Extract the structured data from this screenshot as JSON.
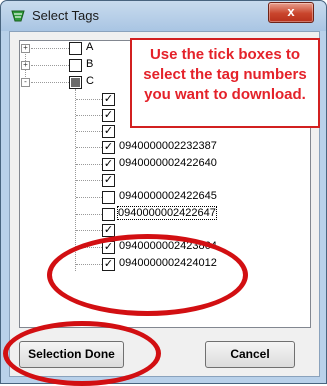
{
  "window": {
    "title": "Select Tags",
    "close_label": "x"
  },
  "tree": {
    "groups": [
      {
        "label": "A",
        "expander": "+"
      },
      {
        "label": "B",
        "expander": "+"
      },
      {
        "label": "C",
        "expander": "-"
      }
    ],
    "items": [
      {
        "label": "0940000002232387",
        "checked": true
      },
      {
        "label": "0940000002422640",
        "checked": true
      },
      {
        "label": "0940000002422645",
        "checked": false
      },
      {
        "label": "0940000002422647",
        "checked": false
      },
      {
        "label": "0940000002423864",
        "checked": true
      },
      {
        "label": "0940000002424012",
        "checked": true
      }
    ],
    "check_mark": "✓"
  },
  "callout": {
    "text": "Use the tick boxes to select the tag numbers you want to download."
  },
  "buttons": {
    "done": "Selection Done",
    "cancel": "Cancel"
  },
  "colors": {
    "annotation_red": "#d20f12",
    "callout_text": "#e4222a"
  }
}
